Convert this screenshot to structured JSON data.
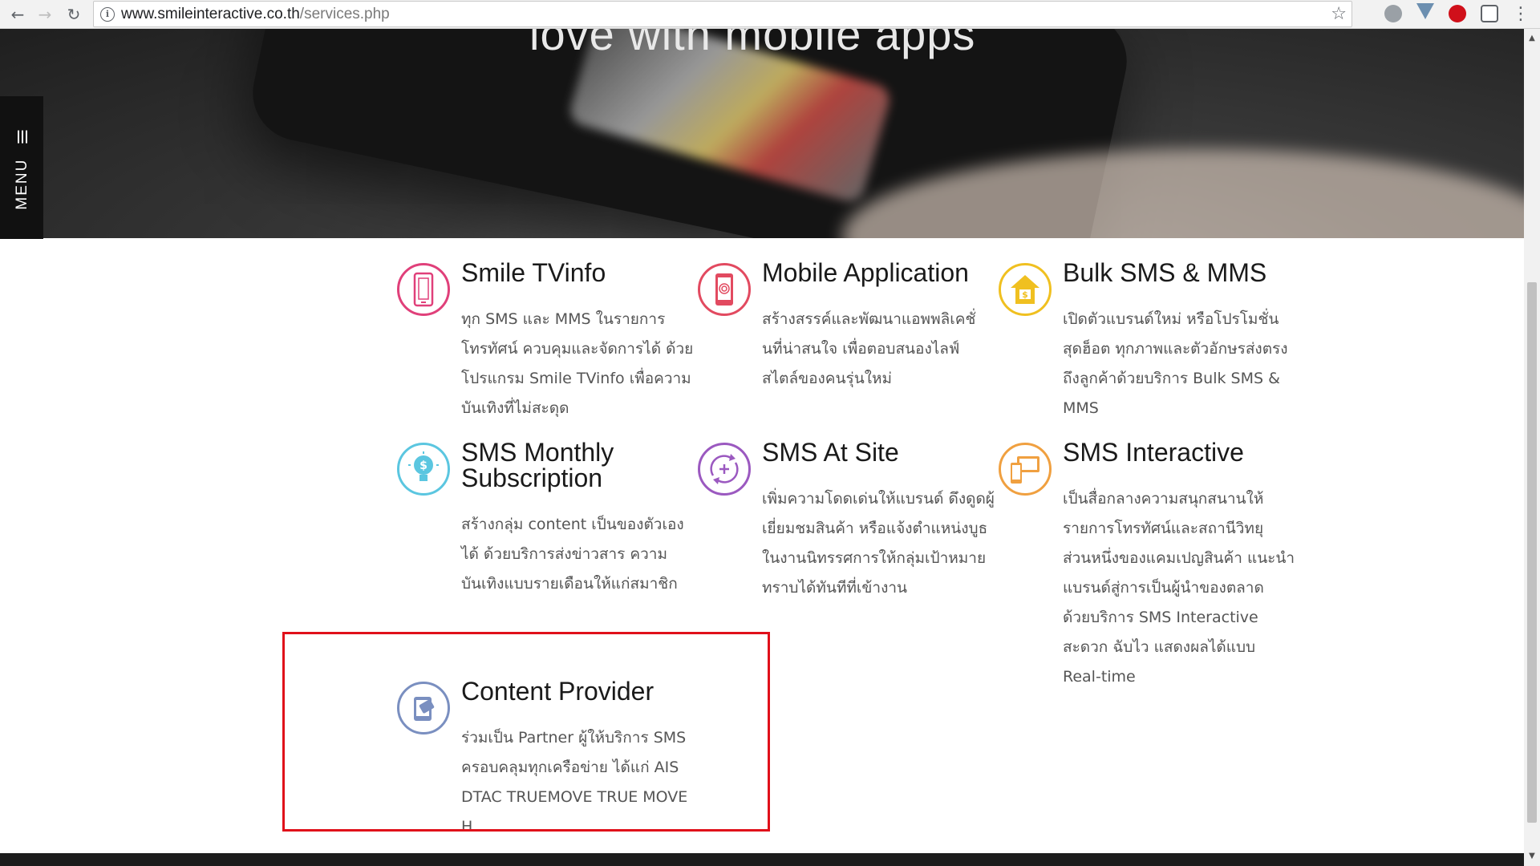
{
  "browser": {
    "url_domain": "www.smileinteractive.co.th",
    "url_path": "/services.php"
  },
  "hero": {
    "text": "love with mobile apps"
  },
  "menu": {
    "label": "MENU"
  },
  "services": [
    {
      "title": "Smile TVinfo",
      "desc": "ทุก SMS และ MMS ในรายการโทรทัศน์ ควบคุมและจัดการได้ ด้วยโปรแกรม Smile TVinfo เพื่อความบันเทิงที่ไม่สะดุด",
      "icon": "phone-icon",
      "color": "#e0407a"
    },
    {
      "title": "Mobile Application",
      "desc": "สร้างสรรค์และพัฒนาแอพพลิเคชั่นที่น่าสนใจ เพื่อตอบสนองไลฟ์สไตล์ของคนรุ่นใหม่",
      "icon": "fingerprint-phone-icon",
      "color": "#e24a60"
    },
    {
      "title": "Bulk SMS & MMS",
      "desc": "เปิดตัวแบรนด์ใหม่ หรือโปรโมชั่นสุดฮ็อต ทุกภาพและตัวอักษรส่งตรงถึงลูกค้าด้วยบริการ Bulk SMS & MMS",
      "icon": "house-money-icon",
      "color": "#f0c020"
    },
    {
      "title": "SMS Monthly Subscription",
      "desc": "สร้างกลุ่ม content เป็นของตัวเองได้ ด้วยบริการส่งข่าวสาร ความบันเทิงแบบรายเดือนให้แก่สมาชิก",
      "icon": "lightbulb-dollar-icon",
      "color": "#5bc6e0"
    },
    {
      "title": "SMS At Site",
      "desc": "เพิ่มความโดดเด่นให้แบรนด์ ดึงดูดผู้เยี่ยมชมสินค้า หรือแจ้งตำแหน่งบูธในงานนิทรรศการให้กลุ่มเป้าหมายทราบได้ทันทีที่เข้างาน",
      "icon": "location-exchange-icon",
      "color": "#9b59c0"
    },
    {
      "title": "SMS Interactive",
      "desc": "เป็นสื่อกลางความสนุกสนานให้รายการโทรทัศน์และสถานีวิทยุ ส่วนหนึ่งของแคมเปญสินค้า แนะนำแบรนด์สู่การเป็นผู้นำของตลาด ด้วยบริการ SMS Interactive สะดวก ฉับไว แสดงผลได้แบบ Real-time",
      "icon": "devices-icon",
      "color": "#f0a040"
    },
    {
      "title": "Content Provider",
      "desc": "ร่วมเป็น Partner ผู้ให้บริการ SMS ครอบคลุมทุกเครือข่าย ได้แก่ AIS DTAC TRUEMOVE TRUE MOVE H",
      "icon": "content-card-icon",
      "color": "#7a8fc0"
    }
  ]
}
